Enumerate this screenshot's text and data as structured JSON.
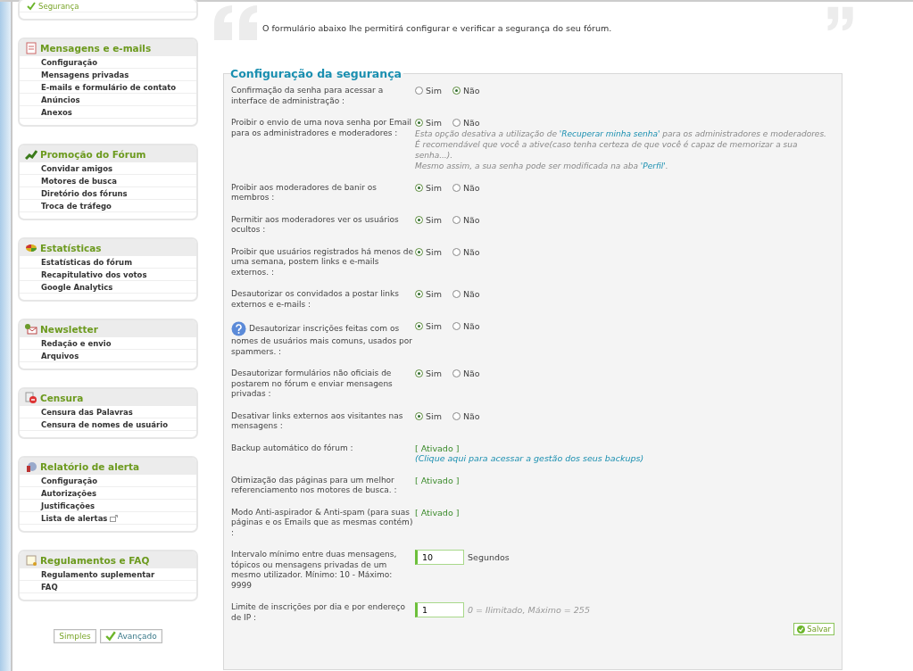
{
  "sidebar": {
    "sections": [
      {
        "items": [
          {
            "label": "Segurança",
            "current": true,
            "external": false
          }
        ]
      },
      {
        "title": "Mensagens e e-mails",
        "items": [
          {
            "label": "Configuração",
            "current": false,
            "external": false
          },
          {
            "label": "Mensagens privadas",
            "current": false,
            "external": false
          },
          {
            "label": "E-mails e formulário de contato",
            "current": false,
            "external": false
          },
          {
            "label": "Anúncios",
            "current": false,
            "external": false
          },
          {
            "label": "Anexos",
            "current": false,
            "external": false
          }
        ]
      },
      {
        "title": "Promoção do Fórum",
        "items": [
          {
            "label": "Convidar amigos",
            "current": false,
            "external": false
          },
          {
            "label": "Motores de busca",
            "current": false,
            "external": false
          },
          {
            "label": "Diretório dos fóruns",
            "current": false,
            "external": false
          },
          {
            "label": "Troca de tráfego",
            "current": false,
            "external": false
          }
        ]
      },
      {
        "title": "Estatísticas",
        "items": [
          {
            "label": "Estatísticas do fórum",
            "current": false,
            "external": false
          },
          {
            "label": "Recapitulativo dos votos",
            "current": false,
            "external": false
          },
          {
            "label": "Google Analytics",
            "current": false,
            "external": false
          }
        ]
      },
      {
        "title": "Newsletter",
        "items": [
          {
            "label": "Redação e envio",
            "current": false,
            "external": false
          },
          {
            "label": "Arquivos",
            "current": false,
            "external": false
          }
        ]
      },
      {
        "title": "Censura",
        "items": [
          {
            "label": "Censura das Palavras",
            "current": false,
            "external": false
          },
          {
            "label": "Censura de nomes de usuário",
            "current": false,
            "external": false
          }
        ]
      },
      {
        "title": "Relatório de alerta",
        "items": [
          {
            "label": "Configuração",
            "current": false,
            "external": false
          },
          {
            "label": "Autorizações",
            "current": false,
            "external": false
          },
          {
            "label": "Justificações",
            "current": false,
            "external": false
          },
          {
            "label": "Lista de alertas",
            "current": false,
            "external": true
          }
        ]
      },
      {
        "title": "Regulamentos e FAQ",
        "items": [
          {
            "label": "Regulamento suplementar",
            "current": false,
            "external": false
          },
          {
            "label": "FAQ",
            "current": false,
            "external": false
          }
        ]
      }
    ],
    "modes": [
      {
        "label": "Simples",
        "selected": false
      },
      {
        "label": "Avançado",
        "selected": true
      }
    ]
  },
  "intro": "O formulário abaixo lhe permitirá configurar e verificar a segurança do seu fórum.",
  "form": {
    "title": "Configuração da segurança",
    "rows": [
      {
        "kind": "radio",
        "label": "Confirmação da senha para acessar a interface de administração :",
        "help": false,
        "options": [
          {
            "label": "Sim",
            "selected": false
          },
          {
            "label": "Não",
            "selected": true
          }
        ]
      },
      {
        "kind": "radio",
        "label": "Proibir o envio de uma nova senha por Email para os administradores e moderadores :",
        "help": false,
        "options": [
          {
            "label": "Sim",
            "selected": true
          },
          {
            "label": "Não",
            "selected": false
          }
        ],
        "note": [
          [
            {
              "kind": "text",
              "text": "Esta opção desativa a utilização de "
            },
            {
              "kind": "link",
              "text": "'Recuperar minha senha'"
            },
            {
              "kind": "text",
              "text": " para os administradores e moderadores."
            }
          ],
          [
            {
              "kind": "text",
              "text": "É recomendável que você a ative(caso tenha certeza de que você é capaz de memorizar a sua senha...)."
            }
          ],
          [
            {
              "kind": "text",
              "text": "Mesmo assim, a sua senha pode ser modificada na aba "
            },
            {
              "kind": "link",
              "text": "'Perfil'"
            },
            {
              "kind": "text",
              "text": "."
            }
          ]
        ]
      },
      {
        "kind": "radio",
        "label": "Proibir aos moderadores de banir os membros :",
        "help": false,
        "options": [
          {
            "label": "Sim",
            "selected": true
          },
          {
            "label": "Não",
            "selected": false
          }
        ]
      },
      {
        "kind": "radio",
        "label": "Permitir aos moderadores ver os usuários ocultos :",
        "help": false,
        "options": [
          {
            "label": "Sim",
            "selected": true
          },
          {
            "label": "Não",
            "selected": false
          }
        ]
      },
      {
        "kind": "radio",
        "label": "Proibir que usuários registrados há menos de uma semana, postem links e e-mails externos. :",
        "help": false,
        "options": [
          {
            "label": "Sim",
            "selected": true
          },
          {
            "label": "Não",
            "selected": false
          }
        ]
      },
      {
        "kind": "radio",
        "label": "Desautorizar os convidados a postar links externos e e-mails :",
        "help": false,
        "options": [
          {
            "label": "Sim",
            "selected": true
          },
          {
            "label": "Não",
            "selected": false
          }
        ]
      },
      {
        "kind": "radio",
        "label": "Desautorizar inscrições feitas com os nomes de usuários mais comuns, usados por spammers. :",
        "help": true,
        "options": [
          {
            "label": "Sim",
            "selected": true
          },
          {
            "label": "Não",
            "selected": false
          }
        ]
      },
      {
        "kind": "radio",
        "label": "Desautorizar formulários não oficiais de postarem no fórum e enviar mensagens privadas :",
        "help": false,
        "options": [
          {
            "label": "Sim",
            "selected": true
          },
          {
            "label": "Não",
            "selected": false
          }
        ]
      },
      {
        "kind": "radio",
        "label": "Desativar links externos aos visitantes nas mensagens :",
        "help": false,
        "options": [
          {
            "label": "Sim",
            "selected": true
          },
          {
            "label": "Não",
            "selected": false
          }
        ]
      },
      {
        "kind": "status",
        "label": "Backup automático do fórum :",
        "help": false,
        "value": "[ Ativado ]",
        "link": "(Clique aqui para acessar a gestão dos seus backups)"
      },
      {
        "kind": "status",
        "label": "Otimização das páginas para um melhor referenciamento nos motores de busca. :",
        "help": false,
        "value": "[ Ativado ]"
      },
      {
        "kind": "status",
        "label": "Modo Anti-aspirador & Anti-spam (para suas páginas e os Emails que as mesmas contém) :",
        "help": false,
        "value": "[ Ativado ]"
      },
      {
        "kind": "input",
        "label": "Intervalo mínimo entre duas mensagens, tópicos ou mensagens privadas de um mesmo utilizador. Mínimo: 10 - Máximo: 9999",
        "help": false,
        "value": "10",
        "unit": "Segundos"
      },
      {
        "kind": "input",
        "label": "Limite de inscrições por dia e por endereço de IP :",
        "help": false,
        "value": "1",
        "hint": "0 = Ilimitado, Máximo = 255"
      }
    ],
    "save": "Salvar"
  }
}
